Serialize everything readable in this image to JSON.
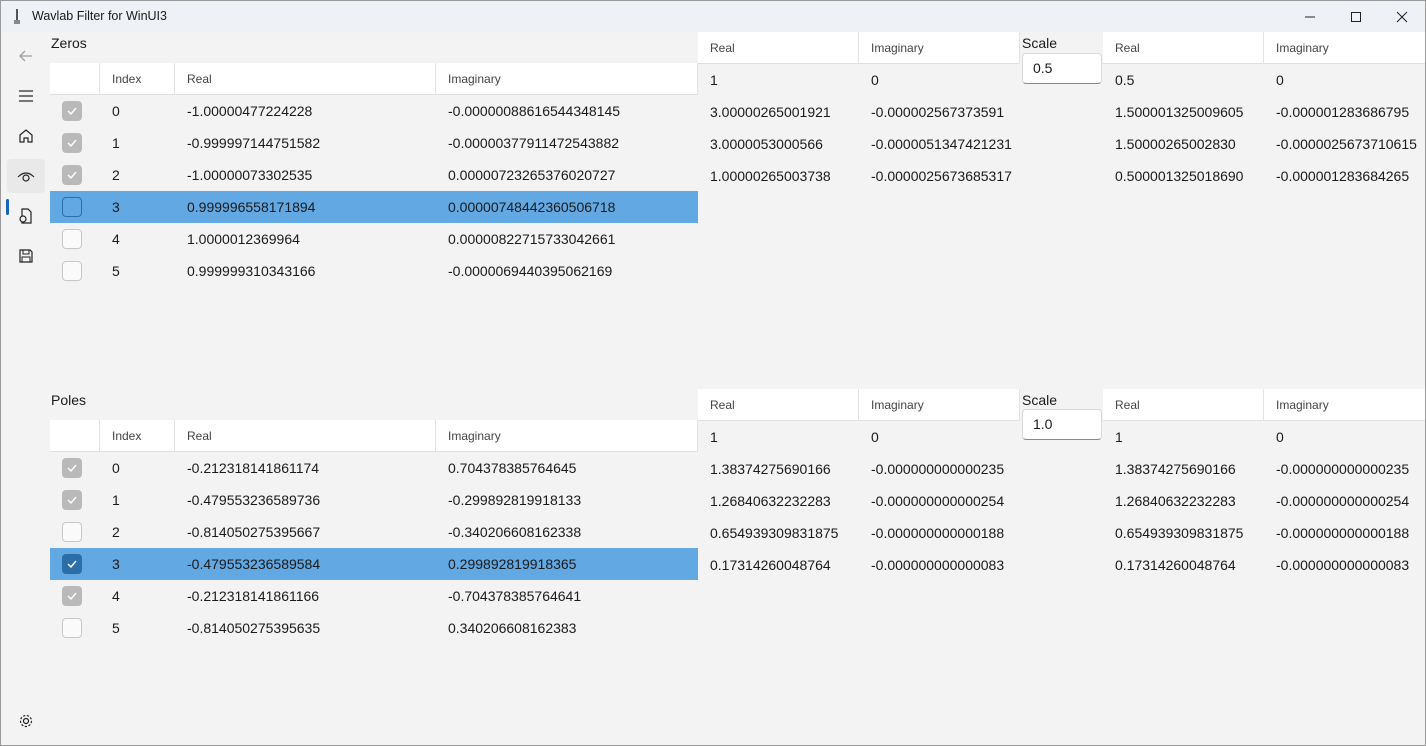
{
  "window": {
    "title": "Wavlab Filter for WinUI3"
  },
  "nav": {
    "items": [
      {
        "name": "back-icon",
        "interactable": true
      },
      {
        "name": "menu-icon",
        "interactable": true
      },
      {
        "name": "home-icon",
        "interactable": true
      },
      {
        "name": "eye-icon",
        "interactable": true,
        "selected": true
      },
      {
        "name": "open-file-icon",
        "interactable": true
      },
      {
        "name": "save-icon",
        "interactable": true
      }
    ],
    "settings": "gear-icon"
  },
  "zeros": {
    "label": "Zeros",
    "headers": {
      "index": "Index",
      "real": "Real",
      "imaginary": "Imaginary"
    },
    "rows": [
      {
        "checked": true,
        "index": "0",
        "real": "-1.00000477224228",
        "imag": "-0.00000088616544348145"
      },
      {
        "checked": true,
        "index": "1",
        "real": "-0.999997144751582",
        "imag": "-0.00000377911472543882"
      },
      {
        "checked": true,
        "index": "2",
        "real": "-1.00000073302535",
        "imag": "0.00000723265376020727"
      },
      {
        "checked": false,
        "index": "3",
        "real": "0.999996558171894",
        "imag": "0.00000748442360506718",
        "selected": true
      },
      {
        "checked": false,
        "index": "4",
        "real": "1.0000012369964",
        "imag": "0.00000822715733042661"
      },
      {
        "checked": false,
        "index": "5",
        "real": "0.999999310343166",
        "imag": "-0.0000069440395062169"
      }
    ],
    "coeffs": {
      "headers": {
        "real": "Real",
        "imaginary": "Imaginary"
      },
      "rows": [
        {
          "real": "1",
          "imag": "0"
        },
        {
          "real": "3.00000265001921",
          "imag": "-0.000002567373591"
        },
        {
          "real": "3.0000053000566",
          "imag": "-0.0000051347421231"
        },
        {
          "real": "1.00000265003738",
          "imag": "-0.0000025673685317"
        }
      ]
    },
    "scale": {
      "label": "Scale",
      "value": "0.5"
    },
    "scaled": {
      "headers": {
        "real": "Real",
        "imaginary": "Imaginary"
      },
      "rows": [
        {
          "real": "0.5",
          "imag": "0"
        },
        {
          "real": "1.500001325009605",
          "imag": "-0.000001283686795"
        },
        {
          "real": "1.50000265002830",
          "imag": "-0.0000025673710615"
        },
        {
          "real": "0.500001325018690",
          "imag": "-0.000001283684265"
        }
      ]
    }
  },
  "poles": {
    "label": "Poles",
    "headers": {
      "index": "Index",
      "real": "Real",
      "imaginary": "Imaginary"
    },
    "rows": [
      {
        "checked": true,
        "index": "0",
        "real": "-0.212318141861174",
        "imag": "0.704378385764645"
      },
      {
        "checked": true,
        "index": "1",
        "real": "-0.479553236589736",
        "imag": "-0.299892819918133"
      },
      {
        "checked": false,
        "index": "2",
        "real": "-0.814050275395667",
        "imag": "-0.340206608162338"
      },
      {
        "checked": true,
        "index": "3",
        "real": "-0.479553236589584",
        "imag": "0.299892819918365",
        "selected": true
      },
      {
        "checked": true,
        "index": "4",
        "real": "-0.212318141861166",
        "imag": "-0.704378385764641"
      },
      {
        "checked": false,
        "index": "5",
        "real": "-0.814050275395635",
        "imag": "0.340206608162383"
      }
    ],
    "coeffs": {
      "headers": {
        "real": "Real",
        "imaginary": "Imaginary"
      },
      "rows": [
        {
          "real": "1",
          "imag": "0"
        },
        {
          "real": "1.38374275690166",
          "imag": "-0.000000000000235"
        },
        {
          "real": "1.26840632232283",
          "imag": "-0.000000000000254"
        },
        {
          "real": "0.654939309831875",
          "imag": "-0.000000000000188"
        },
        {
          "real": "0.17314260048764",
          "imag": "-0.000000000000083"
        }
      ]
    },
    "scale": {
      "label": "Scale",
      "value": "1.0"
    },
    "scaled": {
      "headers": {
        "real": "Real",
        "imaginary": "Imaginary"
      },
      "rows": [
        {
          "real": "1",
          "imag": "0"
        },
        {
          "real": "1.38374275690166",
          "imag": "-0.000000000000235"
        },
        {
          "real": "1.26840632232283",
          "imag": "-0.000000000000254"
        },
        {
          "real": "0.654939309831875",
          "imag": "-0.000000000000188"
        },
        {
          "real": "0.17314260048764",
          "imag": "-0.000000000000083"
        }
      ]
    }
  }
}
